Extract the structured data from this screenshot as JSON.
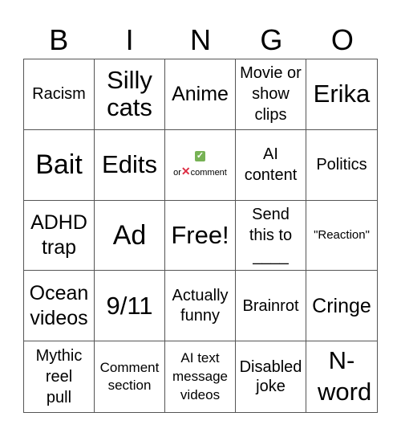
{
  "header": {
    "letters": [
      "B",
      "I",
      "N",
      "G",
      "O"
    ]
  },
  "cells": [
    {
      "text": "Racism"
    },
    {
      "text": "Silly cats"
    },
    {
      "text": "Anime"
    },
    {
      "text": "Movie or show clips"
    },
    {
      "text": "Erika"
    },
    {
      "text": "Bait"
    },
    {
      "text": "Edits"
    },
    {
      "text": "comment",
      "prefix": "or",
      "icons": [
        "check-mark-icon",
        "cross-mark-icon"
      ]
    },
    {
      "text": "AI content"
    },
    {
      "text": "Politics"
    },
    {
      "text": "ADHD trap"
    },
    {
      "text": "Ad"
    },
    {
      "text": "Free!"
    },
    {
      "text": "Send this to ____"
    },
    {
      "text": "\"Reaction\""
    },
    {
      "text": "Ocean videos"
    },
    {
      "text": "9/11"
    },
    {
      "text": "Actually funny"
    },
    {
      "text": "Brainrot"
    },
    {
      "text": "Cringe"
    },
    {
      "text": "Mythic reel pull"
    },
    {
      "text": "Comment section"
    },
    {
      "text": "AI text message videos"
    },
    {
      "text": "Disabled joke"
    },
    {
      "text": "N-word"
    }
  ],
  "colors": {
    "grid_line": "#555555",
    "check": "#77b255",
    "cross": "#dd2e44"
  }
}
